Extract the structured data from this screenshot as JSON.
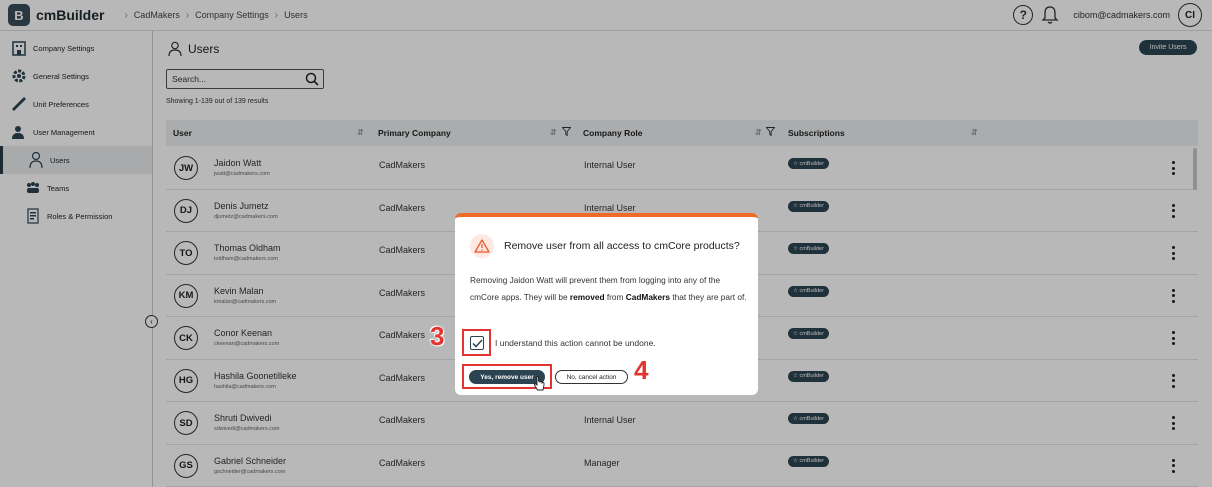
{
  "app": {
    "logo_letter": "B",
    "name": "cmBuilder"
  },
  "breadcrumb": [
    "CadMakers",
    "Company Settings",
    "Users"
  ],
  "header": {
    "user_email": "cibom@cadmakers.com",
    "user_initials": "CI",
    "help_label": "?"
  },
  "sidebar": {
    "items": [
      {
        "label": "Company Settings",
        "icon": "building-icon"
      },
      {
        "label": "General Settings",
        "icon": "gear-icon"
      },
      {
        "label": "Unit Preferences",
        "icon": "ruler-icon"
      },
      {
        "label": "User Management",
        "icon": "user-group-icon"
      },
      {
        "label": "Users",
        "icon": "user-icon",
        "active": true
      },
      {
        "label": "Teams",
        "icon": "team-icon"
      },
      {
        "label": "Roles & Permission",
        "icon": "roles-icon"
      }
    ]
  },
  "page": {
    "title": "Users",
    "invite_label": "Invite Users",
    "search_placeholder": "Search...",
    "results_text": "Showing 1-139 out of 139 results"
  },
  "table": {
    "columns": [
      "User",
      "Primary Company",
      "Company Role",
      "Subscriptions"
    ],
    "rows": [
      {
        "initials": "JW",
        "name": "Jaidon Watt",
        "email": "jwatt@cadmakers.com",
        "company": "CadMakers",
        "role": "Internal User",
        "subscription": "☆ cmBuilder"
      },
      {
        "initials": "DJ",
        "name": "Denis Jumetz",
        "email": "djumetz@cadmakers.com",
        "company": "CadMakers",
        "role": "Internal User",
        "subscription": "☆ cmBuilder"
      },
      {
        "initials": "TO",
        "name": "Thomas Oldham",
        "email": "toldham@cadmakers.com",
        "company": "CadMakers",
        "role": "",
        "subscription": "☆ cmBuilder"
      },
      {
        "initials": "KM",
        "name": "Kevin Malan",
        "email": "kmalan@cadmakers.com",
        "company": "CadMakers",
        "role": "",
        "subscription": "☆ cmBuilder"
      },
      {
        "initials": "CK",
        "name": "Conor Keenan",
        "email": "ckeenan@cadmakers.com",
        "company": "CadMakers",
        "role": "",
        "subscription": "☆ cmBuilder"
      },
      {
        "initials": "HG",
        "name": "Hashila Goonetilleke",
        "email": "hashila@cadmakers.com",
        "company": "CadMakers",
        "role": "",
        "subscription": "☆ cmBuilder"
      },
      {
        "initials": "SD",
        "name": "Shruti Dwivedi",
        "email": "sdwivedi@cadmakers.com",
        "company": "CadMakers",
        "role": "Internal User",
        "subscription": "☆ cmBuilder"
      },
      {
        "initials": "GS",
        "name": "Gabriel Schneider",
        "email": "gschneider@cadmakers.com",
        "company": "CadMakers",
        "role": "Manager",
        "subscription": "☆ cmBuilder"
      }
    ]
  },
  "modal": {
    "title": "Remove user from all access to cmCore products?",
    "body_pre": "Removing Jaidon Watt will prevent them from logging into any of the cmCore apps. They will be ",
    "body_bold1": "removed",
    "body_mid": " from ",
    "body_bold2": "CadMakers",
    "body_post": " that they are part of.",
    "checkbox_label": "I understand this action cannot be undone.",
    "checkbox_checked": true,
    "confirm_label": "Yes, remove user",
    "cancel_label": "No, cancel action"
  },
  "annotations": {
    "step3": "3",
    "step4": "4"
  },
  "colors": {
    "primary": "#2c4452",
    "warning": "#f06a2a",
    "highlight": "#e3342f"
  }
}
